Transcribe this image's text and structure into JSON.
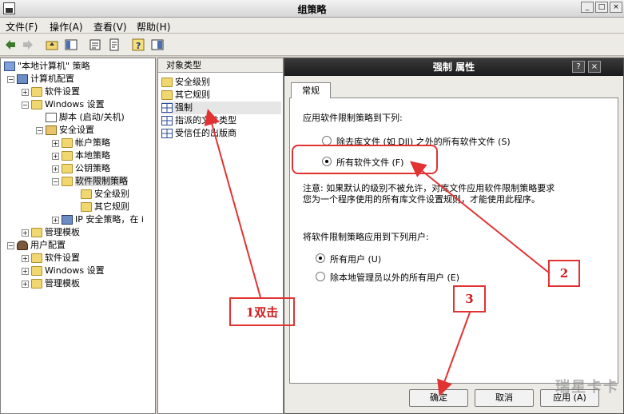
{
  "window": {
    "title": "组策略"
  },
  "menu": {
    "file": "文件(F)",
    "action": "操作(A)",
    "view": "查看(V)",
    "help": "帮助(H)"
  },
  "tree": {
    "root": "\"本地计算机\" 策略",
    "computer_config": "计算机配置",
    "software_settings": "软件设置",
    "windows_settings": "Windows 设置",
    "scripts": "脚本 (启动/关机)",
    "security_settings": "安全设置",
    "account_policy": "帐户策略",
    "local_policy": "本地策略",
    "public_key_policy": "公钥策略",
    "software_restriction": "软件限制策略",
    "security_levels": "安全级别",
    "other_rules": "其它规则",
    "ip_security": "IP 安全策略，在 i",
    "admin_templates": "管理模板",
    "user_config": "用户配置",
    "user_software_settings": "软件设置",
    "user_windows_settings": "Windows 设置",
    "user_admin_templates": "管理模板"
  },
  "list": {
    "header": "对象类型",
    "items": [
      "安全级别",
      "其它规则",
      "强制",
      "指派的文件类型",
      "受信任的出版商"
    ]
  },
  "dialog": {
    "title": "强制 属性",
    "tab": "常规",
    "apply_to_label": "应用软件限制策略到下列:",
    "option_except_libs": "除去库文件 (如 Dll) 之外的所有软件文件 (S)",
    "option_all_files": "所有软件文件 (F)",
    "note_line1": "注意:   如果默认的级别不被允许，对库文件应用软件限制策略要求",
    "note_line2": "您为一个程序使用的所有库文件设置规则，才能使用此程序。",
    "apply_users_label": "将软件限制策略应用到下列用户:",
    "option_all_users": "所有用户 (U)",
    "option_except_admins": "除本地管理员以外的所有用户 (E)",
    "ok": "确定",
    "cancel": "取消",
    "apply": "应用 (A)"
  },
  "annotations": {
    "step1": "1双击",
    "step2": "2",
    "step3": "3"
  },
  "watermark": "瑞星卡卡",
  "colors": {
    "annotation": "#e23333",
    "dialog_title_bg": "#1a1a1a"
  }
}
